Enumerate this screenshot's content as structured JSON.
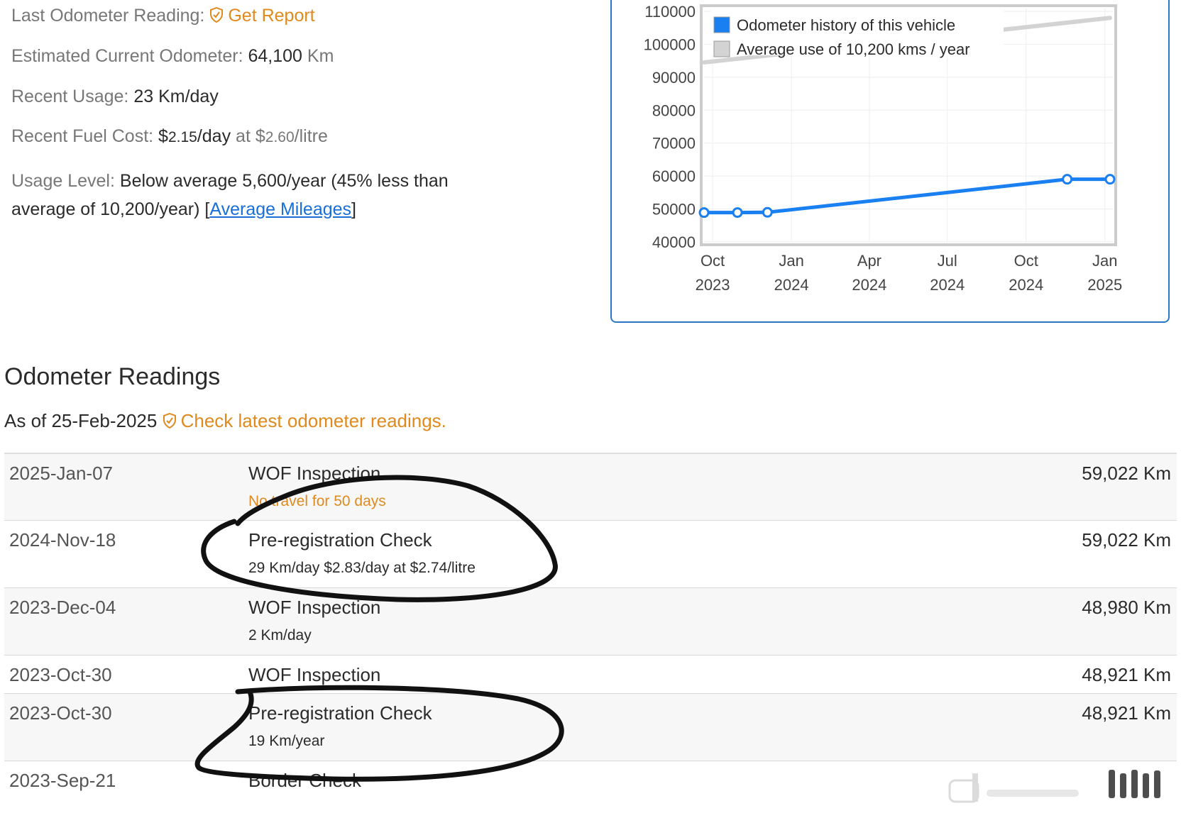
{
  "summary": {
    "last_reading_label": "Last Odometer Reading:",
    "get_report": "Get Report",
    "est_label": "Estimated Current Odometer:",
    "est_value": "64,100",
    "est_unit": "Km",
    "usage_label": "Recent Usage:",
    "usage_value": "23 Km/day",
    "fuel_label": "Recent Fuel Cost:",
    "fuel_dollar": "$",
    "fuel_amount": "2.15",
    "fuel_per": "/day",
    "fuel_at": "at",
    "fuel_price_dollar": "$",
    "fuel_price_amount": "2.60",
    "fuel_price_unit": "/litre",
    "level_label": "Usage Level:",
    "level_value_1": "Below average 5,600/year (45% less than",
    "level_value_2": "average of 10,200/year)",
    "bracket_open": "[",
    "avg_link": "Average Mileages",
    "bracket_close": "]"
  },
  "chart_data": {
    "type": "line",
    "ylim": [
      40000,
      110000
    ],
    "yticks": [
      "40000",
      "50000",
      "60000",
      "70000",
      "80000",
      "90000",
      "100000",
      "110000"
    ],
    "xticks": [
      {
        "month": "Oct",
        "year": "2023",
        "date": "2023-10-01"
      },
      {
        "month": "Jan",
        "year": "2024",
        "date": "2024-01-01"
      },
      {
        "month": "Apr",
        "year": "2024",
        "date": "2024-04-01"
      },
      {
        "month": "Jul",
        "year": "2024",
        "date": "2024-07-01"
      },
      {
        "month": "Oct",
        "year": "2024",
        "date": "2024-10-01"
      },
      {
        "month": "Jan",
        "year": "2025",
        "date": "2025-01-01"
      }
    ],
    "xlim": [
      "2023-09-21",
      "2025-01-07"
    ],
    "legend": [
      "Odometer history of this vehicle",
      "Average use of 10,200 kms / year"
    ],
    "legend_position": "top-left",
    "grid": true,
    "series": [
      {
        "name": "Odometer history of this vehicle",
        "color": "#1a7ff0",
        "points": [
          {
            "x": "2023-09-21",
            "y": 48900
          },
          {
            "x": "2023-10-30",
            "y": 48921
          },
          {
            "x": "2023-12-04",
            "y": 48980
          },
          {
            "x": "2024-11-18",
            "y": 59022
          },
          {
            "x": "2025-01-07",
            "y": 59022
          }
        ]
      },
      {
        "name": "Average use of 10,200 kms / year",
        "color": "#d3d3d3",
        "points": [
          {
            "x": "2023-09-21",
            "y": 94500
          },
          {
            "x": "2025-01-07",
            "y": 108000
          }
        ]
      }
    ]
  },
  "section": {
    "title": "Odometer Readings",
    "as_of": "As of 25-Feb-2025",
    "check_latest": "Check latest odometer readings."
  },
  "readings": [
    {
      "date": "2025-Jan-07",
      "type": "WOF Inspection",
      "sub": "No travel for 50 days",
      "warn": true,
      "km": "59,022 Km"
    },
    {
      "date": "2024-Nov-18",
      "type": "Pre-registration Check",
      "sub": "29 Km/day $2.83/day at $2.74/litre",
      "warn": false,
      "km": "59,022 Km"
    },
    {
      "date": "2023-Dec-04",
      "type": "WOF Inspection",
      "sub": "2 Km/day",
      "warn": false,
      "km": "48,980 Km"
    },
    {
      "date": "2023-Oct-30",
      "type": "WOF Inspection",
      "sub": "",
      "warn": false,
      "km": "48,921 Km"
    },
    {
      "date": "2023-Oct-30",
      "type": "Pre-registration Check",
      "sub": "19 Km/year",
      "warn": false,
      "km": "48,921 Km"
    },
    {
      "date": "2023-Sep-21",
      "type": "Border Check",
      "sub": "",
      "warn": false,
      "km": ""
    }
  ],
  "colors": {
    "accent_orange": "#e08a1e",
    "link_blue": "#1a6fd6",
    "chart_border": "#2a77c5"
  }
}
